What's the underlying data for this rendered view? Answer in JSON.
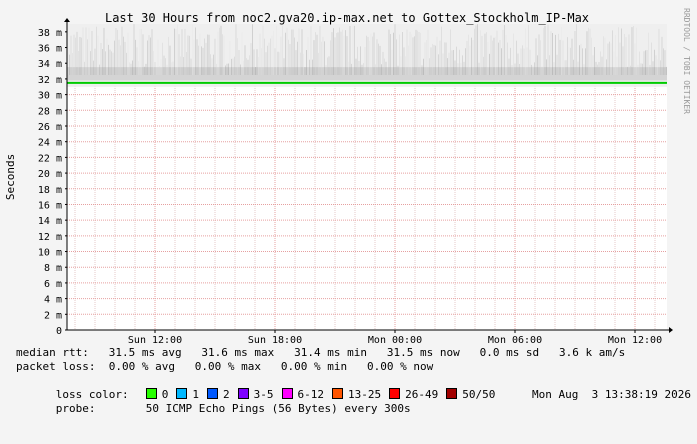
{
  "chart_data": {
    "type": "line",
    "title": "Last 30 Hours from noc2.gva20.ip-max.net to Gottex_Stockholm_IP-Max",
    "ylabel": "Seconds",
    "xlabel": "",
    "watermark": "RRDTOOL / TOBI OETIKER",
    "y_ticks": [
      "0",
      "2 m",
      "4 m",
      "6 m",
      "8 m",
      "10 m",
      "12 m",
      "14 m",
      "16 m",
      "18 m",
      "20 m",
      "22 m",
      "24 m",
      "26 m",
      "28 m",
      "30 m",
      "32 m",
      "34 m",
      "36 m",
      "38 m"
    ],
    "ylim": [
      0,
      0.039
    ],
    "x_ticks": [
      "Sun 12:00",
      "Sun 18:00",
      "Mon 00:00",
      "Mon 06:00",
      "Mon 12:00"
    ],
    "x_tick_hours": [
      12,
      18,
      24,
      30,
      36
    ],
    "xlim_hours": [
      7.6,
      37.6
    ],
    "grid": true,
    "series": [
      {
        "median_rtt_ms": 31.5,
        "color": "#00cc00"
      }
    ],
    "smoke_ms": [
      31.0,
      39.0
    ]
  },
  "footer": {
    "median_rtt": "median rtt:   31.5 ms avg   31.6 ms max   31.4 ms min   31.5 ms now   0.0 ms sd   3.6 k am/s",
    "packet_loss": "packet loss:  0.00 % avg   0.00 % max   0.00 % min   0.00 % now",
    "loss_color_label": "loss color:",
    "loss_colors": [
      {
        "label": "0",
        "color": "#26ff00"
      },
      {
        "label": "1",
        "color": "#00b8ff"
      },
      {
        "label": "2",
        "color": "#0059ff"
      },
      {
        "label": "3-5",
        "color": "#7e00ff"
      },
      {
        "label": "6-12",
        "color": "#ff00ff"
      },
      {
        "label": "13-25",
        "color": "#ff5500"
      },
      {
        "label": "26-49",
        "color": "#ff0000"
      },
      {
        "label": "50/50",
        "color": "#a10000"
      }
    ],
    "probe_label": "probe:",
    "probe_text": "50 ICMP Echo Pings (56 Bytes) every 300s",
    "timestamp": "Mon Aug  3 13:38:19 2026"
  }
}
